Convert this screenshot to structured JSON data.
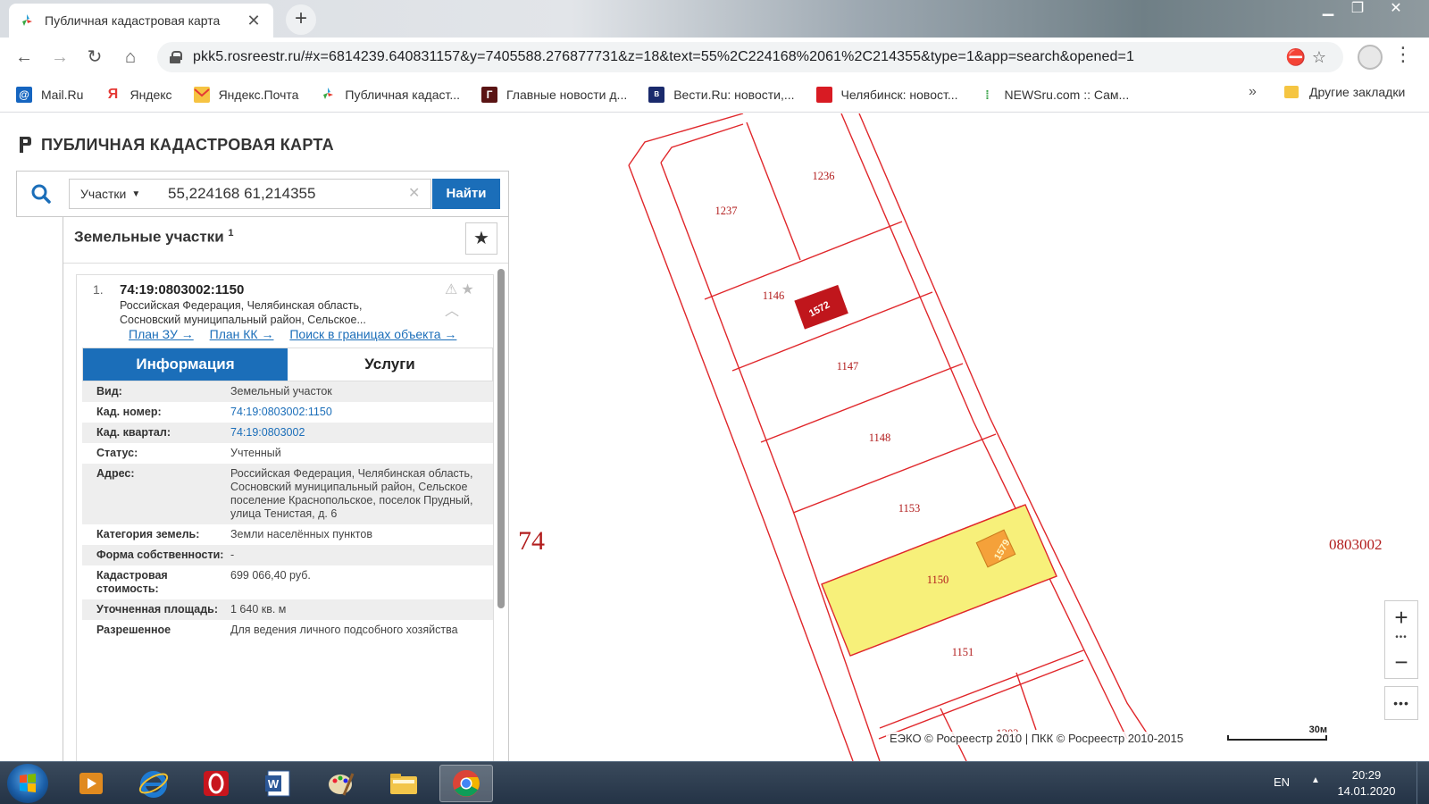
{
  "browser": {
    "tab_title": "Публичная кадастровая карта",
    "url": "pkk5.rosreestr.ru/#x=6814239.640831157&y=7405588.276877731&z=18&text=55%2C224168%2061%2C214355&type=1&app=search&opened=1",
    "bookmarks": [
      "Mail.Ru",
      "Яндекс",
      "Яндекс.Почта",
      "Публичная кадаст...",
      "Главные новости д...",
      "Вести.Ru: новости,...",
      "Челябинск: новост...",
      "NEWSru.com :: Сам..."
    ],
    "bookmarks_more": "»",
    "other_bookmarks": "Другие закладки"
  },
  "app": {
    "title": "ПУБЛИЧНАЯ КАДАСТРОВАЯ КАРТА",
    "search": {
      "type": "Участки",
      "query": "55,224168 61,214355",
      "button": "Найти"
    },
    "results": {
      "title": "Земельные участки",
      "count": "1",
      "item": {
        "num": "1.",
        "id": "74:19:0803002:1150",
        "address_1": "Российская Федерация, Челябинская область,",
        "address_2": "Сосновский муниципальный район, Сельское...",
        "links": [
          "План ЗУ →",
          "План КК →",
          "Поиск в границах объекта →"
        ],
        "tabs": [
          "Информация",
          "Услуги"
        ],
        "info": [
          {
            "k": "Вид:",
            "v": "Земельный участок"
          },
          {
            "k": "Кад. номер:",
            "v": "74:19:0803002:1150"
          },
          {
            "k": "Кад. квартал:",
            "v": "74:19:0803002"
          },
          {
            "k": "Статус:",
            "v": "Учтенный"
          },
          {
            "k": "Адрес:",
            "v": "Российская Федерация, Челябинская область, Сосновский муниципальный район, Сельское поселение Краснопольское, поселок Прудный, улица Тенистая, д. 6"
          },
          {
            "k": "Категория земель:",
            "v": "Земли населённых пунктов"
          },
          {
            "k": "Форма собственности:",
            "v": "-"
          },
          {
            "k": "Кадастровая стоимость:",
            "v": "699 066,40 руб."
          },
          {
            "k": "Уточненная площадь:",
            "v": "1 640 кв. м"
          },
          {
            "k": "Разрешенное",
            "v": "Для ведения личного подсобного хозяйства"
          }
        ]
      }
    }
  },
  "map": {
    "region": "74",
    "quarter": "0803002",
    "parcels": [
      "1236",
      "1237",
      "1146",
      "1147",
      "1148",
      "1153",
      "1150",
      "1151",
      "1202"
    ],
    "buildings": [
      "1572",
      "1579"
    ],
    "attribution": "ЕЭКО © Росреестр 2010 | ПКК © Росреестр 2010-2015",
    "scale": "30м",
    "colors": {
      "boundary": "#e0272b",
      "selected_fill": "#f7f07a",
      "building_red": "#c0161c",
      "building_orange": "#f5a13a"
    }
  },
  "taskbar": {
    "lang": "EN",
    "time": "20:29",
    "date": "14.01.2020"
  }
}
